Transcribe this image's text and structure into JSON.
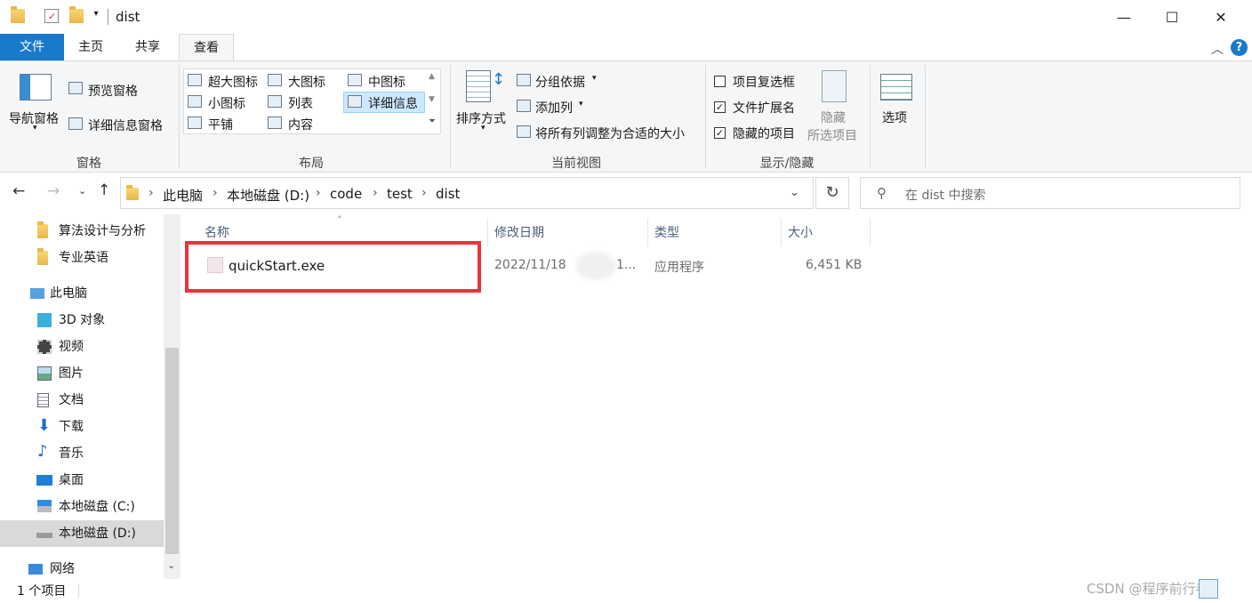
{
  "window": {
    "title": "dist"
  },
  "tabs": [
    {
      "label": "文件"
    },
    {
      "label": "主页"
    },
    {
      "label": "共享"
    },
    {
      "label": "查看"
    }
  ],
  "ribbon": {
    "pane": {
      "nav_pane": "导航窗格",
      "preview_pane": "预览窗格",
      "details_pane": "详细信息窗格",
      "group": "窗格"
    },
    "layout": {
      "items": [
        "超大图标",
        "大图标",
        "中图标",
        "小图标",
        "列表",
        "详细信息",
        "平铺",
        "内容"
      ],
      "group": "布局"
    },
    "current_view": {
      "sort_by": "排序方式",
      "group_by": "分组依据",
      "add_column": "添加列",
      "fit_columns": "将所有列调整为合适的大小",
      "group": "当前视图"
    },
    "show_hide": {
      "item_checkboxes": "项目复选框",
      "file_extensions": "文件扩展名",
      "hidden_items": "隐藏的项目",
      "hide_selected_1": "隐藏",
      "hide_selected_2": "所选项目",
      "group": "显示/隐藏"
    },
    "options": "选项"
  },
  "address": {
    "crumbs": [
      "此电脑",
      "本地磁盘 (D:)",
      "code",
      "test",
      "dist"
    ],
    "search_placeholder": "在 dist 中搜索"
  },
  "nav": {
    "items": [
      {
        "label": "算法设计与分析"
      },
      {
        "label": "专业英语"
      },
      {
        "label": "此电脑"
      },
      {
        "label": "3D 对象"
      },
      {
        "label": "视频"
      },
      {
        "label": "图片"
      },
      {
        "label": "文档"
      },
      {
        "label": "下载"
      },
      {
        "label": "音乐"
      },
      {
        "label": "桌面"
      },
      {
        "label": "本地磁盘 (C:)"
      },
      {
        "label": "本地磁盘 (D:)"
      },
      {
        "label": "网络"
      }
    ]
  },
  "columns": {
    "name": "名称",
    "date": "修改日期",
    "type": "类型",
    "size": "大小"
  },
  "files": [
    {
      "name": "quickStart.exe",
      "date_start": "2022/11/18",
      "date_end": "1...",
      "type": "应用程序",
      "size": "6,451 KB"
    }
  ],
  "status": {
    "count": "1 个项目"
  },
  "watermark": "CSDN @程序前行者",
  "colors": {
    "accent": "#1979ca",
    "highlight_box": "#e8343a",
    "selection": "#cce8ff"
  }
}
